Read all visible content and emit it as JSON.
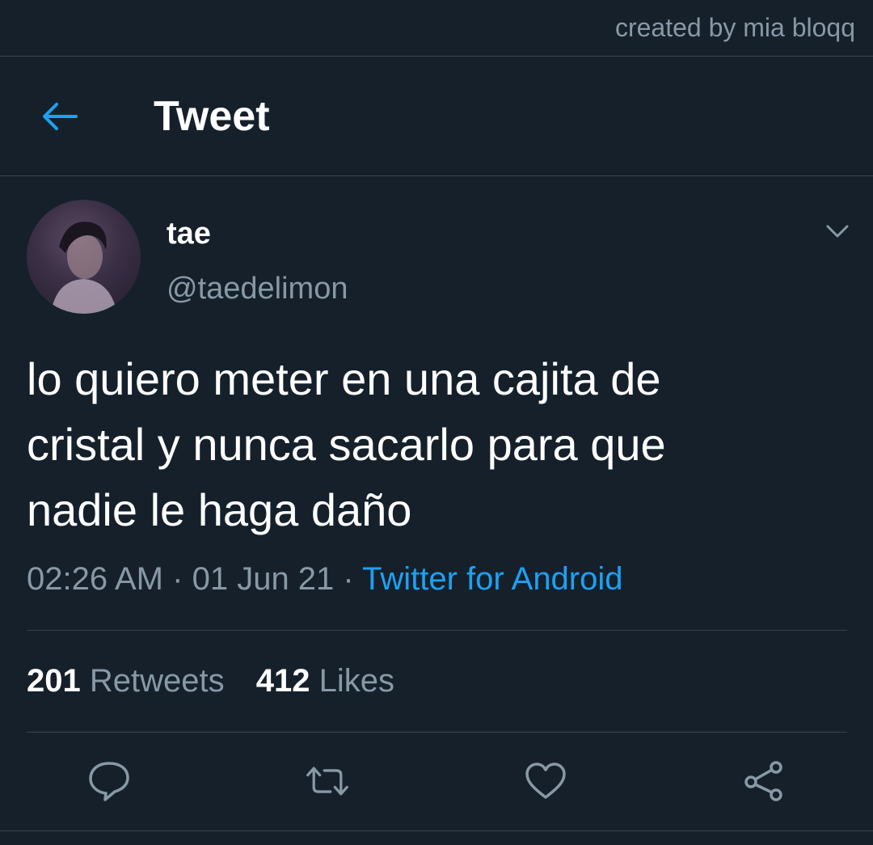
{
  "watermark": "created by mia bloqq",
  "header": {
    "title": "Tweet",
    "back_icon": "arrow-left-icon"
  },
  "tweet": {
    "author_name": "tae",
    "author_handle": "@taedelimon",
    "text": "lo quiero meter en una cajita de\ncristal y nunca sacarlo para que\nnadie le haga daño",
    "time": "02:26 AM",
    "separator": "·",
    "date": "01 Jun 21",
    "source": "Twitter for Android"
  },
  "stats": {
    "retweets_count": "201",
    "retweets_label": "Retweets",
    "likes_count": "412",
    "likes_label": "Likes"
  },
  "actions": [
    "reply-icon",
    "retweet-icon",
    "like-icon",
    "share-icon"
  ],
  "colors": {
    "background": "#15202b",
    "accent": "#1da1f2",
    "muted": "#8899a6",
    "divider": "#38444d"
  }
}
